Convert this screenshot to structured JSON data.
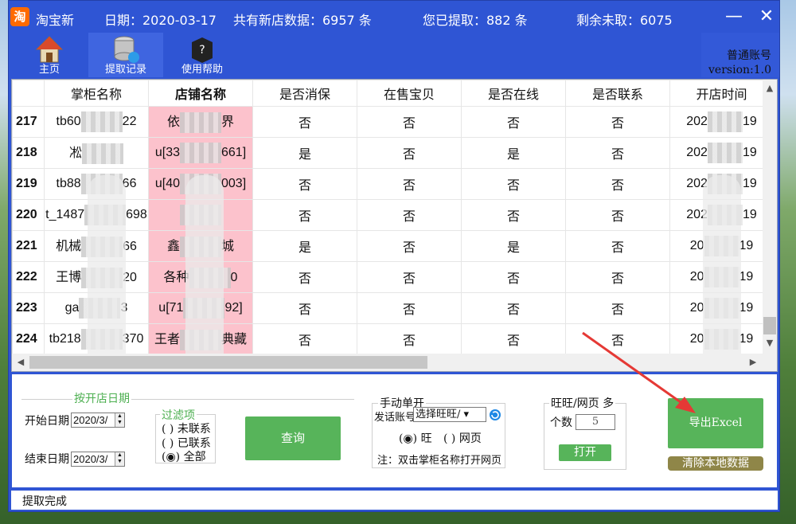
{
  "window": {
    "app_name": "淘宝新",
    "date_info": "日期：2020-03-17",
    "total_info": "共有新店数据：6957 条",
    "extracted_info": "您已提取：882 条",
    "remaining_info": "剩余未取：6075",
    "minimize_glyph": "—",
    "close_glyph": "✕"
  },
  "toolbar": {
    "home_label": "主页",
    "records_label": "提取记录",
    "help_label": "使用帮助"
  },
  "account": {
    "type": "普通账号",
    "version": "version:1.0"
  },
  "grid": {
    "columns": [
      "掌柜名称",
      "店铺名称",
      "是否消保",
      "在售宝贝",
      "是否在线",
      "是否联系",
      "开店时间"
    ],
    "rows": [
      {
        "no": "217",
        "owner_a": "tb60",
        "owner_b": "22",
        "shop_a": "依",
        "shop_b": "界",
        "protect": "否",
        "onsale": "否",
        "online": "否",
        "contact": "否",
        "date_a": "202",
        "date_b": "19"
      },
      {
        "no": "218",
        "owner_a": "凇",
        "owner_b": "",
        "shop_a": "u[33",
        "shop_b": "661]",
        "protect": "是",
        "onsale": "否",
        "online": "是",
        "contact": "否",
        "date_a": "202",
        "date_b": "19"
      },
      {
        "no": "219",
        "owner_a": "tb88",
        "owner_b": "66",
        "shop_a": "u[40",
        "shop_b": "003]",
        "protect": "否",
        "onsale": "否",
        "online": "否",
        "contact": "否",
        "date_a": "202",
        "date_b": "19"
      },
      {
        "no": "220",
        "owner_a": "t_1487",
        "owner_b": "698",
        "shop_a": "",
        "shop_b": "",
        "protect": "否",
        "onsale": "否",
        "online": "否",
        "contact": "否",
        "date_a": "202",
        "date_b": "19"
      },
      {
        "no": "221",
        "owner_a": "机械",
        "owner_b": "66",
        "shop_a": "鑫",
        "shop_b": "城",
        "protect": "是",
        "onsale": "否",
        "online": "是",
        "contact": "否",
        "date_a": "20",
        "date_b": "19"
      },
      {
        "no": "222",
        "owner_a": "王博",
        "owner_b": "20",
        "shop_a": "各种",
        "shop_b": "0",
        "protect": "否",
        "onsale": "否",
        "online": "否",
        "contact": "否",
        "date_a": "20",
        "date_b": "19"
      },
      {
        "no": "223",
        "owner_a": "ga",
        "owner_b": "3",
        "shop_a": "u[71",
        "shop_b": "92]",
        "protect": "否",
        "onsale": "否",
        "online": "否",
        "contact": "否",
        "date_a": "20",
        "date_b": "19"
      },
      {
        "no": "224",
        "owner_a": "tb218",
        "owner_b": "370",
        "shop_a": "王者",
        "shop_b": "典藏",
        "protect": "否",
        "onsale": "否",
        "online": "否",
        "contact": "否",
        "date_a": "20",
        "date_b": "19"
      }
    ]
  },
  "date_filter": {
    "legend": "按开店日期",
    "start_label": "开始日期",
    "start_value": "2020/3/",
    "end_label": "结束日期",
    "end_value": "2020/3/"
  },
  "filter": {
    "legend": "过滤项",
    "options": [
      "未联系",
      "已联系",
      "全部"
    ],
    "selected": "全部"
  },
  "query_button": "查询",
  "manual": {
    "legend": "手动单开",
    "account_label": "发话账号",
    "select_value": "选择旺旺/",
    "radio_wang": "旺",
    "radio_web": "网页",
    "note": "注：双击掌柜名称打开网页"
  },
  "wangwang": {
    "legend": "旺旺/网页 多",
    "count_label": "个数",
    "count_value": "5",
    "open_button": "打开"
  },
  "export_button": "导出Excel",
  "clear_button": "清除本地数据",
  "status": "提取完成",
  "colors": {
    "title_blue": "#2f55d4",
    "pink_cell": "#fcc2cc",
    "green_button": "#57b45a",
    "olive_button": "#8f8648",
    "annotation_red": "#e53935"
  }
}
